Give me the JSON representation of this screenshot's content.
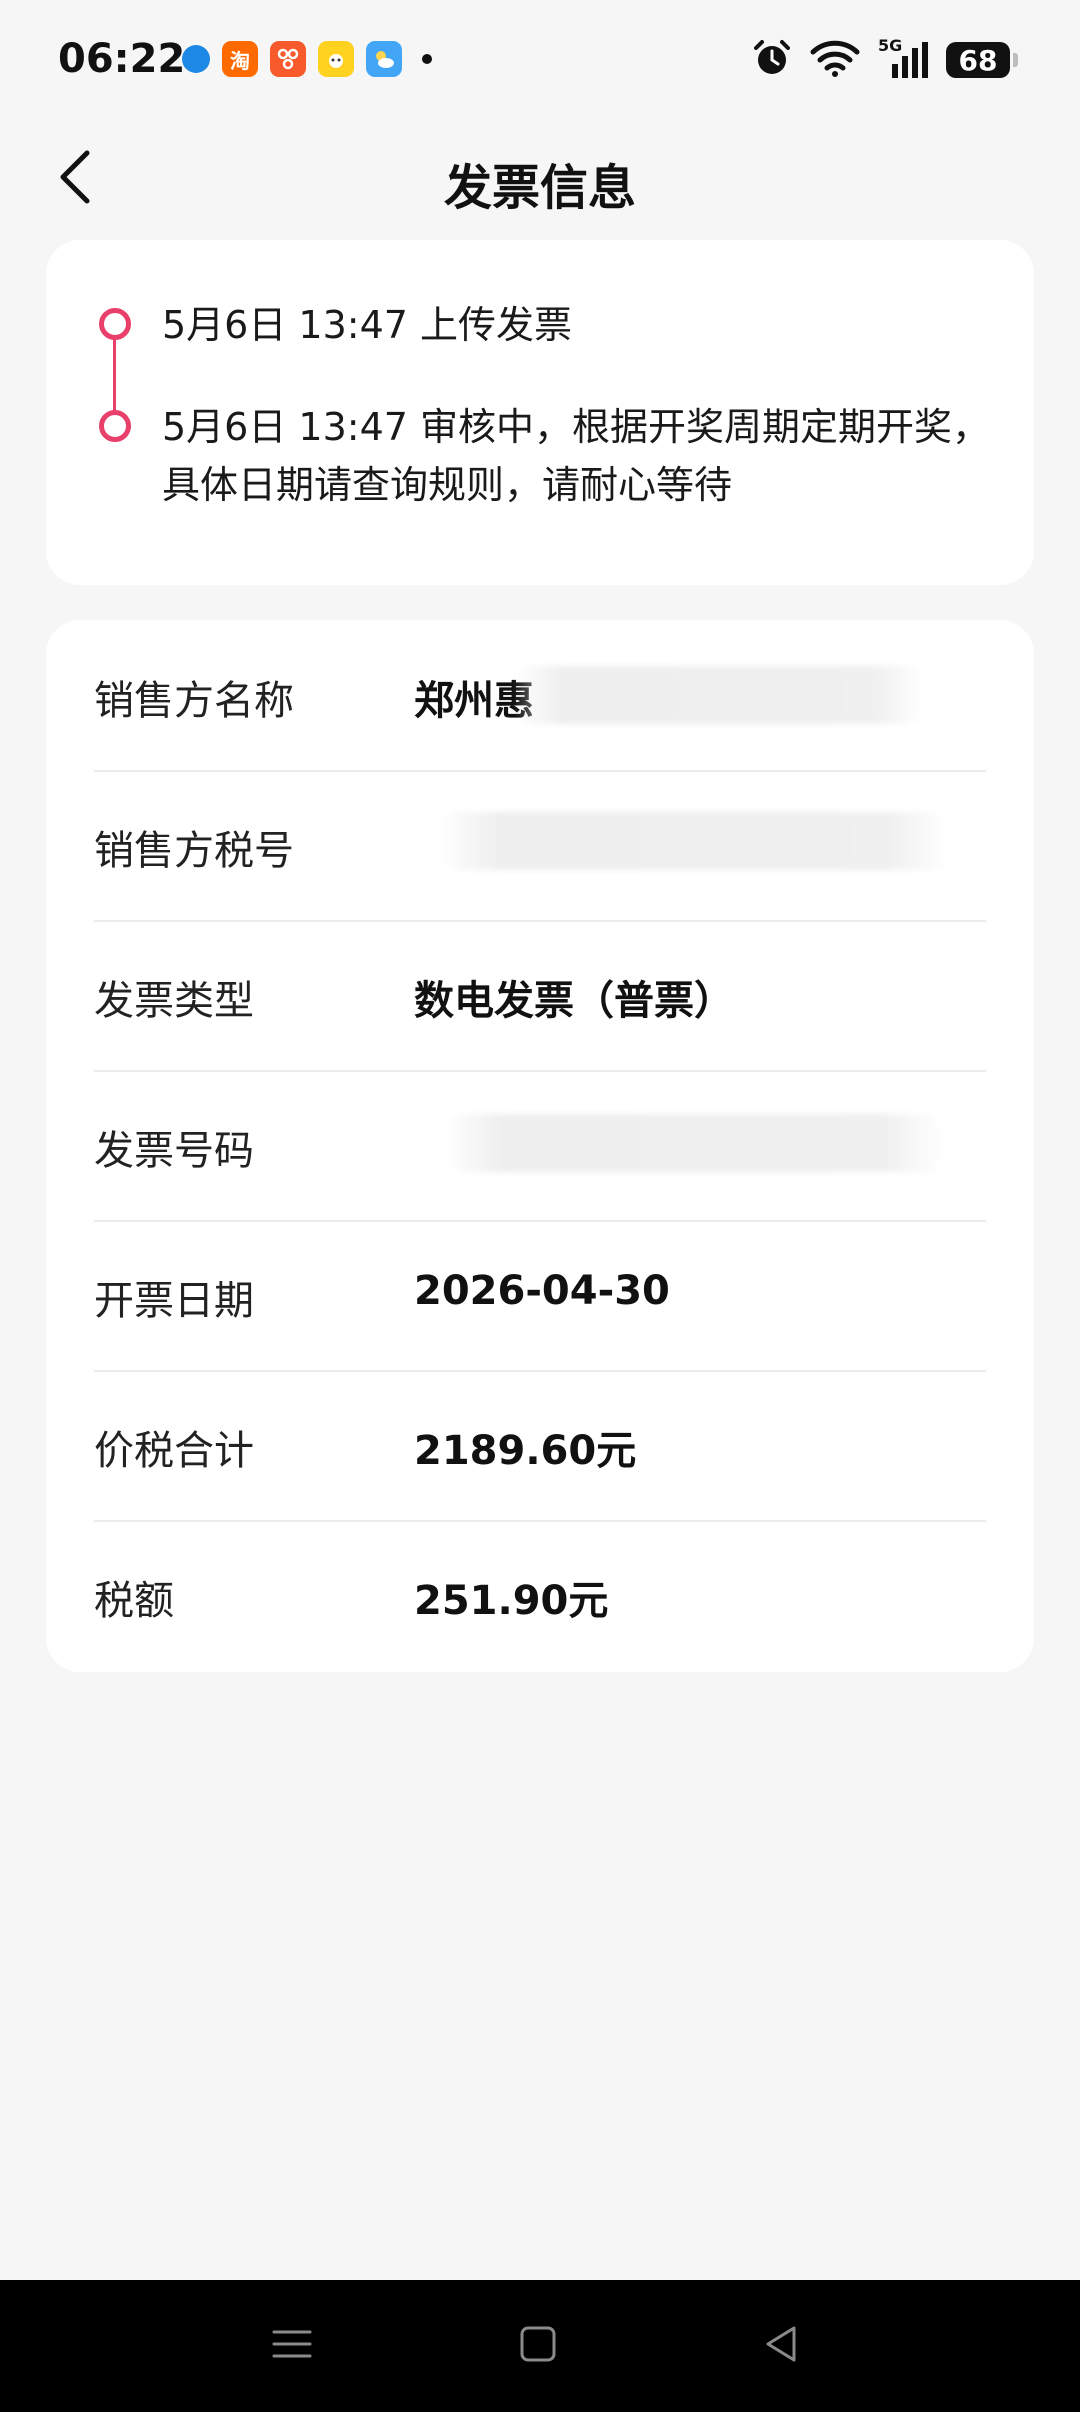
{
  "status_bar": {
    "time": "06:22",
    "battery": "68",
    "network": "5G"
  },
  "header": {
    "title": "发票信息"
  },
  "timeline": [
    {
      "time": "5月6日 13:47",
      "text": "上传发票"
    },
    {
      "time": "5月6日 13:47",
      "text": "审核中，根据开奖周期定期开奖，具体日期请查询规则，请耐心等待"
    }
  ],
  "info": [
    {
      "label": "销售方名称",
      "value": "郑州惠"
    },
    {
      "label": "销售方税号",
      "value": ""
    },
    {
      "label": "发票类型",
      "value": "数电发票（普票）"
    },
    {
      "label": "发票号码",
      "value": ""
    },
    {
      "label": "开票日期",
      "value": "2026-04-30"
    },
    {
      "label": "价税合计",
      "value": "2189.60元"
    },
    {
      "label": "税额",
      "value": "251.90元"
    }
  ],
  "colors": {
    "accent": "#e8406a",
    "background": "#f6f6f6",
    "card": "#ffffff"
  },
  "icons": {
    "back": "chevron-left-icon",
    "alarm": "alarm-icon",
    "wifi": "wifi-icon",
    "signal": "signal-icon",
    "nav_menu": "menu-icon",
    "nav_home": "home-icon",
    "nav_back": "back-triangle-icon"
  }
}
